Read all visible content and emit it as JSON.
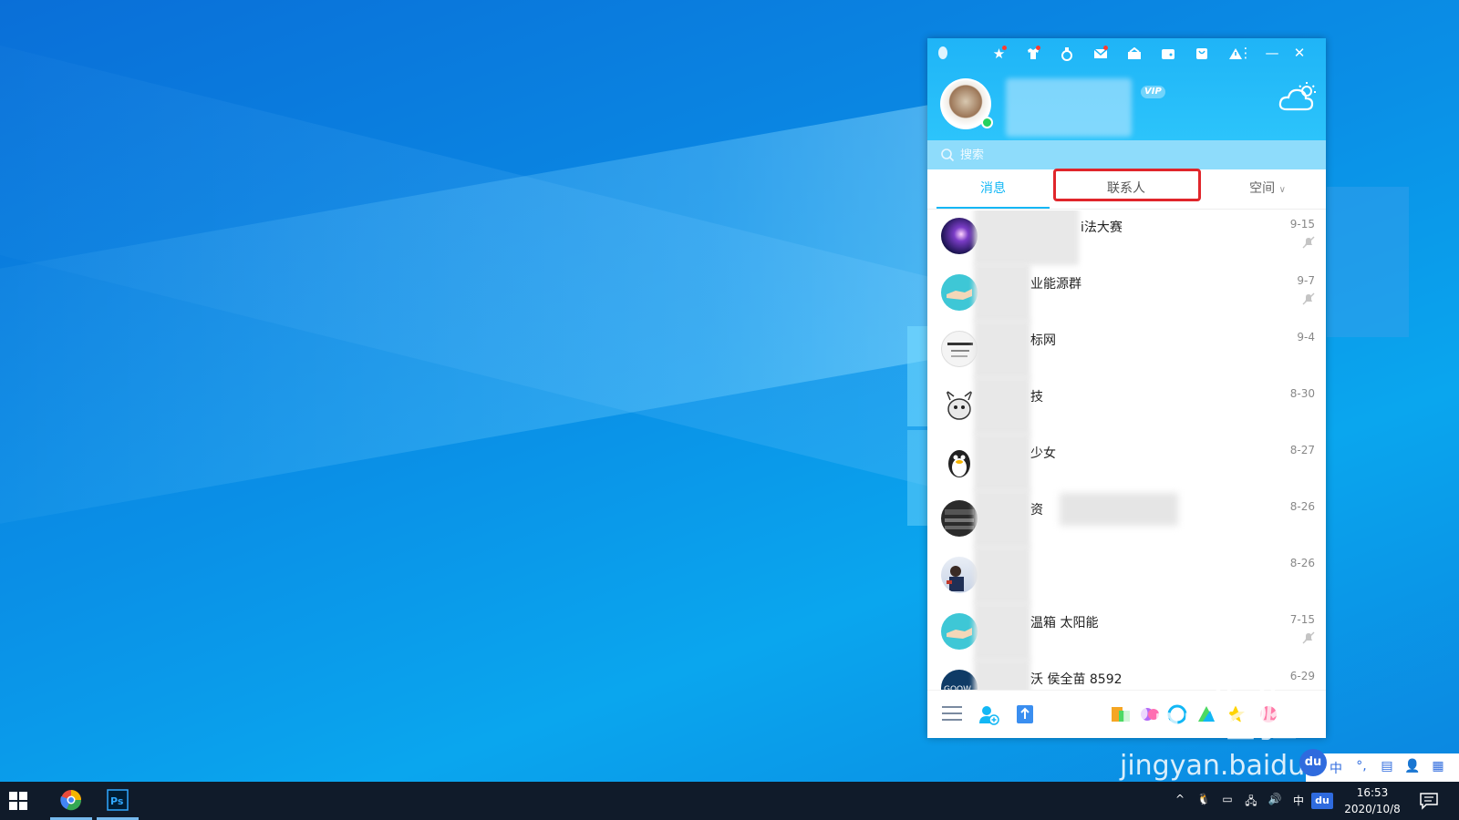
{
  "qq": {
    "vip_label": "VIP",
    "search_placeholder": "搜索",
    "tabs": [
      {
        "label": "消息"
      },
      {
        "label": "联系人"
      },
      {
        "label": "空间"
      }
    ],
    "conversations": [
      {
        "title": "i法大赛",
        "time": "9-15",
        "muted": true
      },
      {
        "title": "业能源群",
        "time": "9-7",
        "muted": true
      },
      {
        "title": "标网",
        "time": "9-4",
        "muted": false
      },
      {
        "title": "技",
        "time": "8-30",
        "muted": false
      },
      {
        "title": "少女",
        "time": "8-27",
        "muted": false
      },
      {
        "title": "资",
        "time": "8-26",
        "muted": false
      },
      {
        "title": "",
        "time": "8-26",
        "muted": false
      },
      {
        "title": "温箱 太阳能",
        "time": "7-15",
        "muted": true
      },
      {
        "title": "沃 侯全苗 8592",
        "time": "6-29",
        "muted": false
      }
    ],
    "accent_color": "#12b7f5",
    "highlight_color": "#e0262b"
  },
  "watermark": {
    "logo": "Bai 经验",
    "url": "jingyan.baidu.com"
  },
  "ime": {
    "logo": "du",
    "buttons": [
      "中",
      "°,",
      "▤",
      "👤",
      "▦"
    ]
  },
  "taskbar": {
    "tray": [
      "^",
      "🐧",
      "▭",
      "🖧",
      "🔊",
      "中",
      "du"
    ],
    "time": "16:53",
    "date": "2020/10/8",
    "notification_count": "1"
  }
}
